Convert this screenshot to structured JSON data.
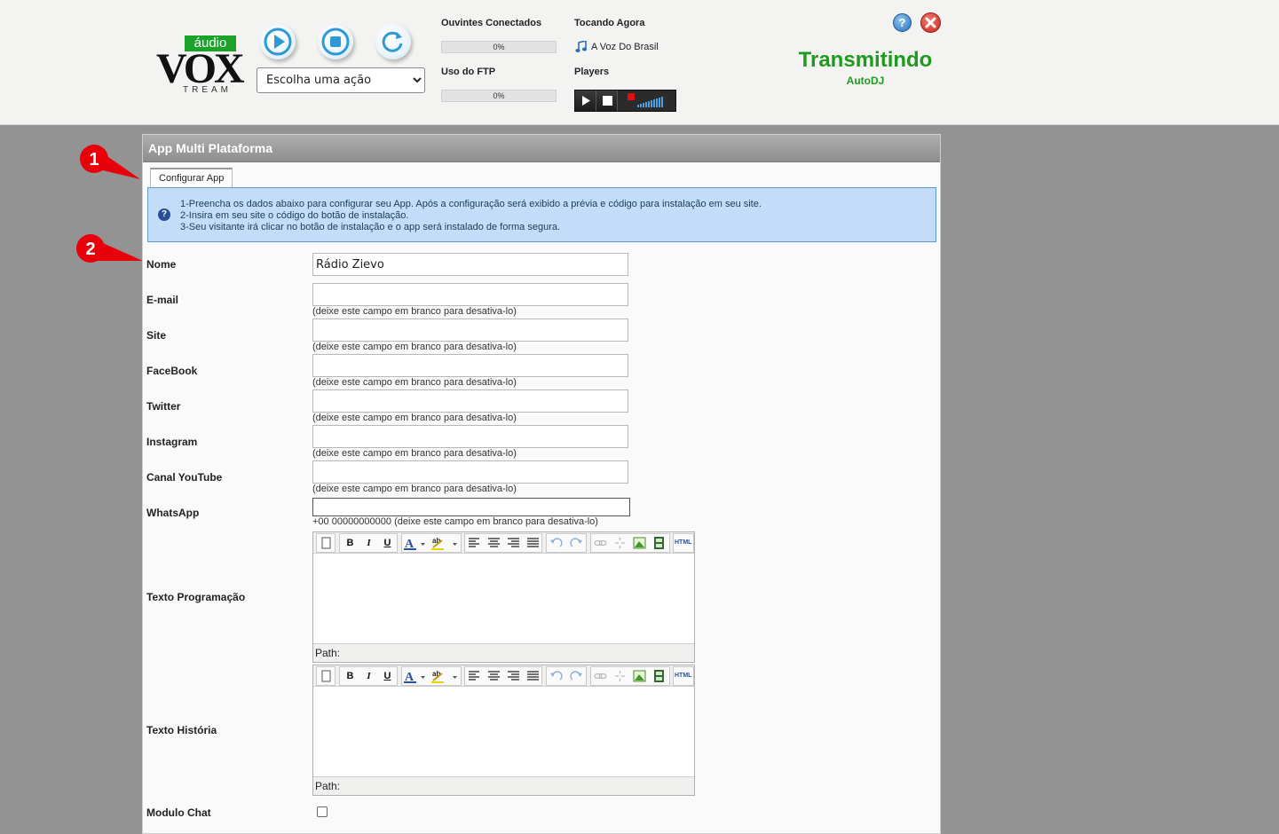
{
  "header": {
    "logo": {
      "badge": "áudio",
      "word": "VOX",
      "sub": "TREAM"
    },
    "controls": [
      "play-icon",
      "stop-icon",
      "refresh-icon"
    ],
    "action_select": {
      "selected": "Escolha uma ação"
    },
    "listeners": {
      "label": "Ouvintes Conectados",
      "progress_text": "0%",
      "progress": 0
    },
    "ftp": {
      "label": "Uso do FTP",
      "progress_text": "0%",
      "progress": 0
    },
    "now_playing": {
      "label": "Tocando Agora",
      "track": "A Voz Do Brasil",
      "icon": "music-note-icon"
    },
    "players": {
      "label": "Players"
    },
    "status": {
      "title": "Transmitindo",
      "subtitle": "AutoDJ"
    },
    "colors": {
      "status": "#1e9a1e",
      "logo_green": "#1aa22a",
      "logo_red": "#c8102e"
    }
  },
  "annotations": {
    "marker1": "1",
    "marker2": "2",
    "color": "#e8000b"
  },
  "panel": {
    "title": "App Multi Plataforma",
    "tab": "Configurar App",
    "info": [
      "1-Preencha os dados abaixo para configurar seu App. Após a configuração será exibido a prévia e código para instalação em seu site.",
      "2-Insira em seu site o código do botão de instalação.",
      "3-Seu visitante irá clicar no botão de instalação e o app será instalado de forma segura."
    ],
    "fields": {
      "nome": {
        "label": "Nome",
        "value": "Rádio Zievo"
      },
      "email": {
        "label": "E-mail",
        "value": "",
        "hint": "(deixe este campo em branco para desativa-lo)"
      },
      "site": {
        "label": "Site",
        "value": "",
        "hint": "(deixe este campo em branco para desativa-lo)"
      },
      "facebook": {
        "label": "FaceBook",
        "value": "",
        "hint": "(deixe este campo em branco para desativa-lo)"
      },
      "twitter": {
        "label": "Twitter",
        "value": "",
        "hint": "(deixe este campo em branco para desativa-lo)"
      },
      "instagram": {
        "label": "Instagram",
        "value": "",
        "hint": "(deixe este campo em branco para desativa-lo)"
      },
      "youtube": {
        "label": "Canal YouTube",
        "value": "",
        "hint": "(deixe este campo em branco para desativa-lo)"
      },
      "whatsapp": {
        "label": "WhatsApp",
        "value": "",
        "hint": "+00 00000000000 (deixe este campo em branco para desativa-lo)"
      }
    },
    "editors": {
      "programacao": {
        "label": "Texto Programação",
        "path": "Path:"
      },
      "historia": {
        "label": "Texto História",
        "path": "Path:"
      },
      "toolbar": {
        "bold": "B",
        "italic": "I",
        "underline": "U",
        "html": "HTML"
      }
    },
    "chat": {
      "label": "Modulo Chat",
      "checked": false
    }
  }
}
